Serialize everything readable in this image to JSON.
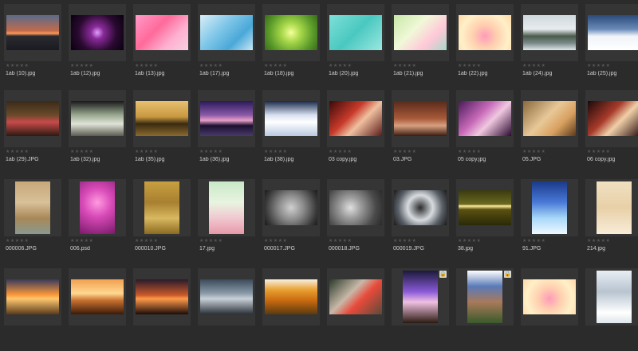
{
  "rating_glyphs": "★★★★★",
  "lock_glyph": "🔒",
  "thumbnails": [
    {
      "name": "1ab (10).jpg",
      "orient": "land",
      "bg": "linear-gradient(180deg,#5a6b8a 0%,#c26b4a 45%,#ff9a5a 52%,#2a2a30 60%,#1a1a22 100%)"
    },
    {
      "name": "1ab (12).jpg",
      "orient": "land",
      "bg": "radial-gradient(circle at 50% 50%,#e0a0ff 0%,#8a2a9a 20%,#2a0a30 60%,#0a0010 100%)"
    },
    {
      "name": "1ab (13).jpg",
      "orient": "land",
      "bg": "linear-gradient(135deg,#ff9ac8 0%,#ff6a9a 40%,#ffb0d0 70%,#f5d0e0 100%)"
    },
    {
      "name": "1ab (17).jpg",
      "orient": "land",
      "bg": "linear-gradient(135deg,#d8eef8 0%,#7fc6e8 40%,#4aa8d8 70%,#c8e8f5 100%)"
    },
    {
      "name": "1ab (18).jpg",
      "orient": "land",
      "bg": "radial-gradient(circle at 50% 50%,#f5ff9a 0%,#a8d84a 30%,#5a9a2a 70%,#3a6a1a 100%)"
    },
    {
      "name": "1ab (20).jpg",
      "orient": "land",
      "bg": "linear-gradient(135deg,#7de0d8 0%,#4ac8c0 50%,#9ae8e0 100%)"
    },
    {
      "name": "1ab (21).jpg",
      "orient": "land",
      "bg": "linear-gradient(135deg,#c8e8a8 0%,#f0f8d8 40%,#ffc8d8 70%,#a8d8c8 100%)"
    },
    {
      "name": "1ab (22).jpg",
      "orient": "land",
      "bg": "radial-gradient(circle at 50% 60%,#ff9ab8 0%,#ffd0b0 35%,#fff0c8 70%,#ffd8a8 100%)"
    },
    {
      "name": "1ab (24).jpg",
      "orient": "land",
      "bg": "linear-gradient(180deg,#cfd8dc 0%,#e8ecee 40%,#4a5a4a 60%,#7a8a8a 80%,#dfe6e8 100%)"
    },
    {
      "name": "1ab (25).jpg",
      "orient": "land",
      "bg": "linear-gradient(180deg,#2a4a7a 0%,#6a8ab8 40%,#f0f4f8 60%,#ffffff 100%)"
    },
    {
      "name": "1ab (29).JPG",
      "orient": "land",
      "bg": "linear-gradient(180deg,#3a2a1a 0%,#6a4a2a 40%,#c84a4a 60%,#2a1a10 100%)"
    },
    {
      "name": "1ab (32).jpg",
      "orient": "land",
      "bg": "linear-gradient(180deg,#1a1a1a 0%,#9aa890 40%,#e0e4d8 65%,#5a5a50 100%)"
    },
    {
      "name": "1ab (35).jpg",
      "orient": "land",
      "bg": "linear-gradient(180deg,#e8c070 0%,#c89840 45%,#3a2a10 65%,#8a6a30 100%)"
    },
    {
      "name": "1ab (36).jpg",
      "orient": "land",
      "bg": "linear-gradient(180deg,#2a1a5a 0%,#8a5aa8 40%,#e8a0c8 55%,#1a1030 70%,#4a3a6a 100%)"
    },
    {
      "name": "1ab (38).jpg",
      "orient": "land",
      "bg": "linear-gradient(180deg,#1a2a4a 0%,#d8e0f0 40%,#ffffff 60%,#b8c8e0 100%)"
    },
    {
      "name": "03 copy.jpg",
      "orient": "land",
      "bg": "linear-gradient(135deg,#3a0a0a 0%,#c83a2a 40%,#f0c0a0 60%,#5a1a1a 100%)"
    },
    {
      "name": "03.JPG",
      "orient": "land",
      "bg": "linear-gradient(180deg,#5a2a1a 0%,#a85a3a 50%,#d8a080 70%,#3a1a10 100%)"
    },
    {
      "name": "05 copy.jpg",
      "orient": "land",
      "bg": "linear-gradient(135deg,#4a1a5a 0%,#c86ab8 40%,#f0c8e0 60%,#2a0a30 100%)"
    },
    {
      "name": "05.JPG",
      "orient": "land",
      "bg": "linear-gradient(135deg,#8a6a3a 0%,#e8c898 45%,#d8a060 70%,#5a3a1a 100%)"
    },
    {
      "name": "06 copy.jpg",
      "orient": "land",
      "bg": "linear-gradient(135deg,#1a0a0a 0%,#a83a2a 40%,#f0d0a8 60%,#2a1010 100%)"
    },
    {
      "name": "000006.JPG",
      "orient": "port",
      "bg": "linear-gradient(180deg,#c8a878 0%,#d8c098 40%,#a88858 70%,#8a9890 100%)"
    },
    {
      "name": "006.psd",
      "orient": "port",
      "bg": "radial-gradient(circle at 50% 40%,#ff9ae0 0%,#d84ab8 40%,#7a1a6a 100%)"
    },
    {
      "name": "000010.JPG",
      "orient": "port",
      "bg": "linear-gradient(180deg,#c8a040 0%,#a88030 40%,#d8b860 70%,#8a6a20 100%)"
    },
    {
      "name": "17.jpg",
      "orient": "port",
      "bg": "linear-gradient(180deg,#c8e8c8 0%,#e8f4e0 40%,#f0c8d0 70%,#e898a8 100%)"
    },
    {
      "name": "000017.JPG",
      "orient": "land",
      "bg": "radial-gradient(circle at 50% 50%,#d0d0d0 0%,#8a8a8a 40%,#3a3a3a 80%,#1a1a1a 100%)"
    },
    {
      "name": "000018.JPG",
      "orient": "land",
      "bg": "radial-gradient(circle at 40% 50%,#e0e0e0 0%,#9a9a9a 30%,#4a4a4a 70%,#2a2a2a 100%)"
    },
    {
      "name": "000019.JPG",
      "orient": "land",
      "bg": "radial-gradient(circle at 50% 50%,#2a2a2a 0%,#d8dce0 40%,#5a6068 70%,#1a1a1a 100%)"
    },
    {
      "name": "38.jpg",
      "orient": "land",
      "bg": "linear-gradient(180deg,#3a3a10 0%,#6a6a20 40%,#fff0a0 45%,#5a5010 55%,#2a2a08 100%)"
    },
    {
      "name": "91.JPG",
      "orient": "port",
      "bg": "linear-gradient(180deg,#1a3a8a 0%,#4a7ad8 40%,#a8d8f8 70%,#f0f8ff 100%)"
    },
    {
      "name": "214.jpg",
      "orient": "port",
      "bg": "linear-gradient(180deg,#f0e0c0 0%,#e8d0a8 50%,#f8ecd8 100%)"
    },
    {
      "name": "",
      "orient": "land",
      "bg": "linear-gradient(180deg,#3a3a5a 0%,#ff9a3a 45%,#ffc870 55%,#5a3a1a 100%)"
    },
    {
      "name": "",
      "orient": "land",
      "bg": "linear-gradient(180deg,#f0a050 0%,#ffd890 40%,#c87030 60%,#3a1a08 100%)"
    },
    {
      "name": "",
      "orient": "land",
      "bg": "linear-gradient(180deg,#2a1a2a 0%,#c85a2a 45%,#ff9a4a 55%,#1a0a08 100%)"
    },
    {
      "name": "",
      "orient": "land",
      "bg": "linear-gradient(180deg,#3a4a5a 0%,#8a9aa8 40%,#c8d0d8 55%,#2a3038 100%)"
    },
    {
      "name": "",
      "orient": "land",
      "bg": "linear-gradient(180deg,#f8f0e0 0%,#e8a030 30%,#c86a10 60%,#5a3a10 100%)"
    },
    {
      "name": "",
      "orient": "land",
      "bg": "linear-gradient(135deg,#2a3a2a 0%,#c8b8a8 40%,#e84a3a 60%,#5a4a3a 100%)"
    },
    {
      "name": "",
      "orient": "port",
      "bg": "linear-gradient(180deg,#1a1a3a 0%,#8a5ad8 40%,#f0c0e0 60%,#2a1a10 100%)",
      "lock": true
    },
    {
      "name": "",
      "orient": "port",
      "bg": "linear-gradient(180deg,#ffffff 0%,#5a7ab8 30%,#a87a5a 60%,#3a5a2a 100%)",
      "lock": true
    },
    {
      "name": "",
      "orient": "land",
      "bg": "radial-gradient(circle at 50% 55%,#ff9ab8 0%,#ffd0b0 35%,#fff0c8 70%,#ffd8a8 100%)"
    },
    {
      "name": "",
      "orient": "port",
      "bg": "linear-gradient(180deg,#e8eef4 0%,#b8c4d0 40%,#ffffff 80%,#dfe6ec 100%)"
    }
  ]
}
